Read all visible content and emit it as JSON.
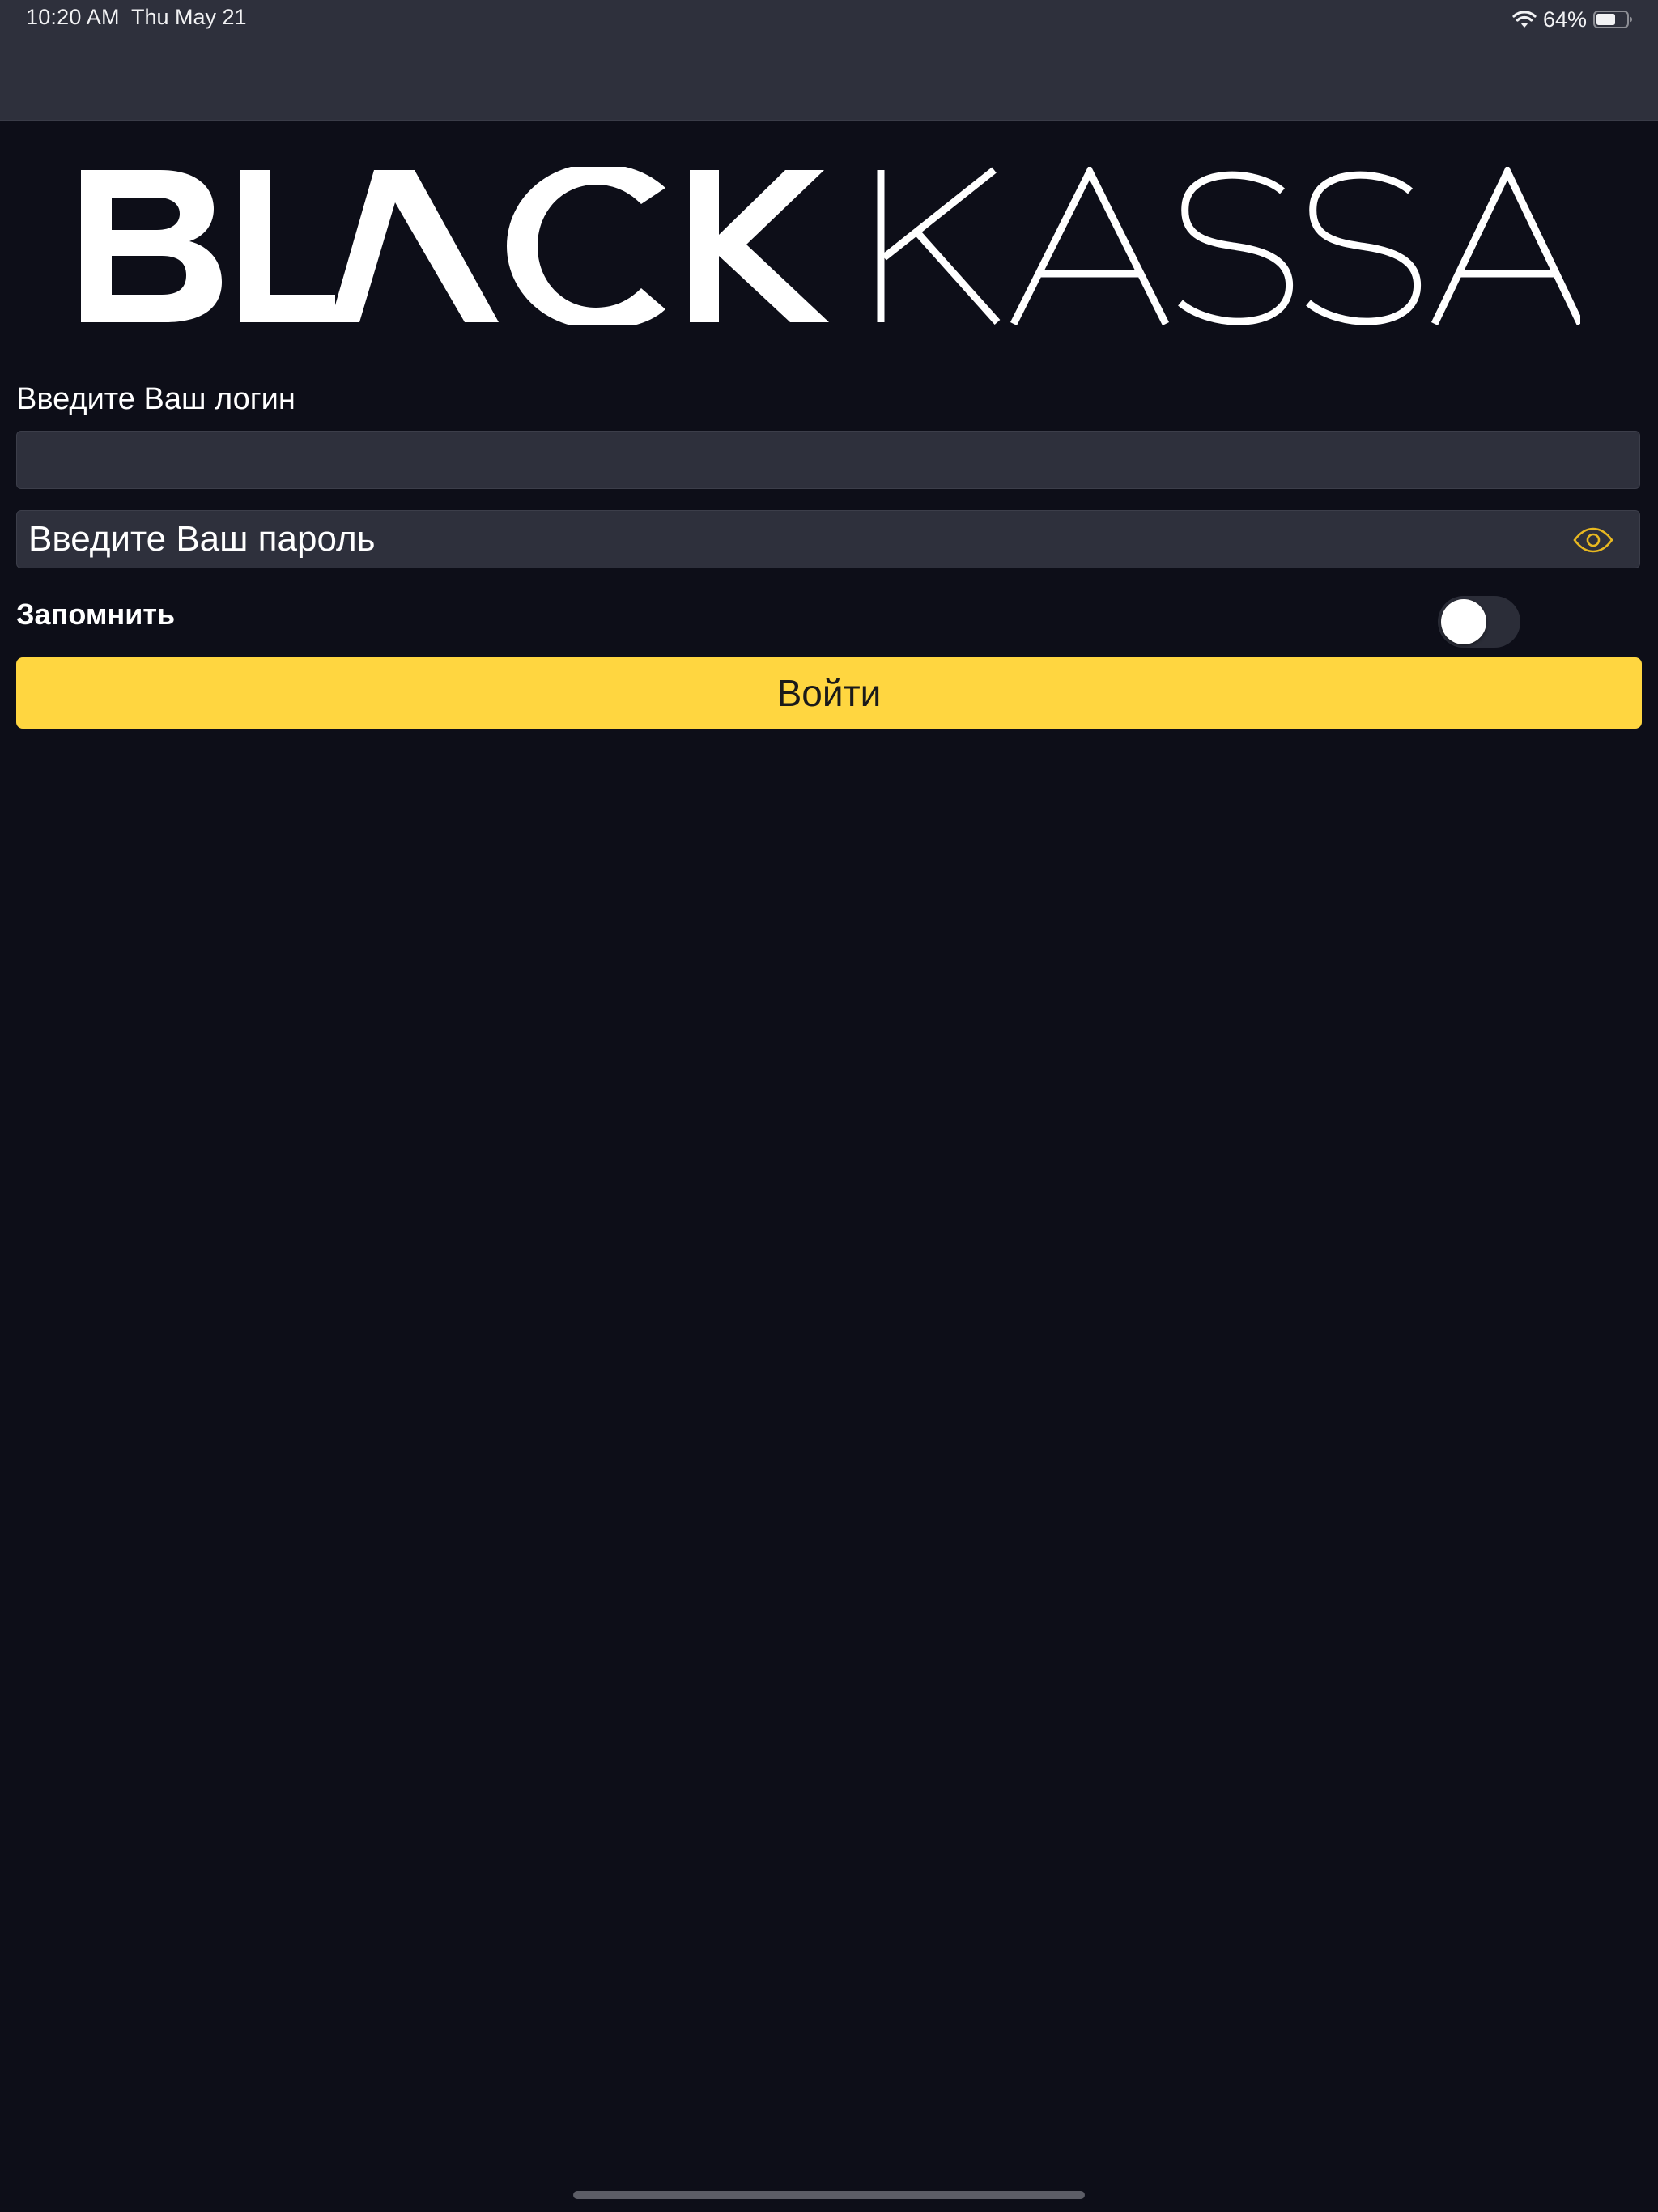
{
  "status_bar": {
    "time": "10:20 AM",
    "date": "Thu May 21",
    "battery_percent": "64%",
    "battery_level": 0.64,
    "icons": [
      "wifi-icon",
      "battery-icon"
    ]
  },
  "brand": {
    "logo_text": "BLACK KASSA",
    "logo_bold": "BLACK",
    "logo_light": "KASSA"
  },
  "login": {
    "label": "Введите Ваш логин",
    "value": ""
  },
  "password": {
    "placeholder": "Введите Ваш пароль",
    "value": "",
    "toggle_icon": "eye-icon"
  },
  "remember": {
    "label": "Запомнить",
    "enabled": false
  },
  "submit": {
    "label": "Войти"
  },
  "colors": {
    "background": "#0d0e18",
    "header": "#2e303c",
    "field": "#2e303c",
    "accent": "#ffd640",
    "text": "#ffffff"
  }
}
